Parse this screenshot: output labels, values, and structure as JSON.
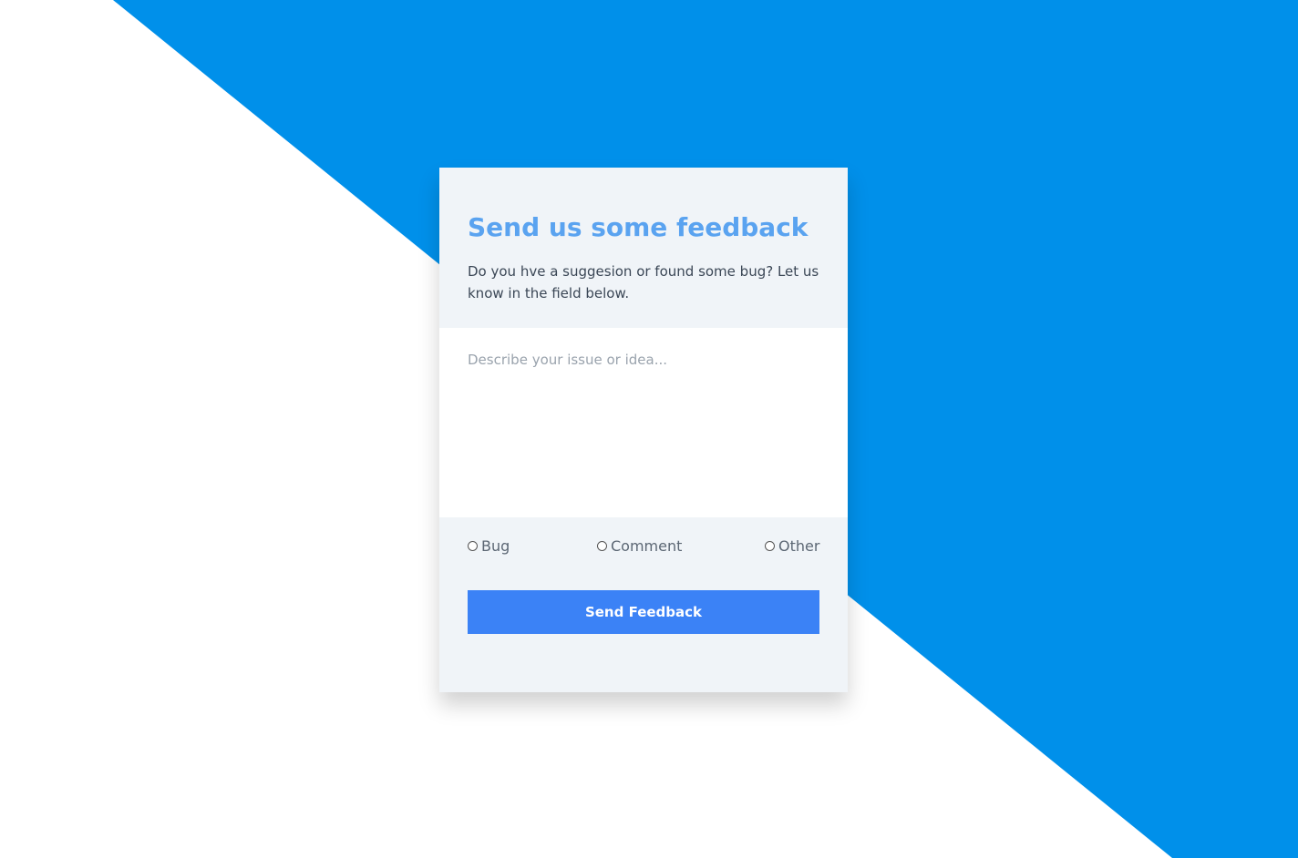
{
  "colors": {
    "background": "#ffffff",
    "accent_shape": "#0090ea",
    "card": "#f0f4f8",
    "title": "#5aa3f0",
    "button": "#3b82f6"
  },
  "card": {
    "title": "Send us some feedback",
    "subtitle": "Do you hve a suggesion or found some bug? Let us know in the field below.",
    "textarea_placeholder": "Describe your issue or idea...",
    "options": [
      {
        "label": "Bug",
        "selected": false
      },
      {
        "label": "Comment",
        "selected": false
      },
      {
        "label": "Other",
        "selected": false
      }
    ],
    "submit_label": "Send Feedback"
  }
}
